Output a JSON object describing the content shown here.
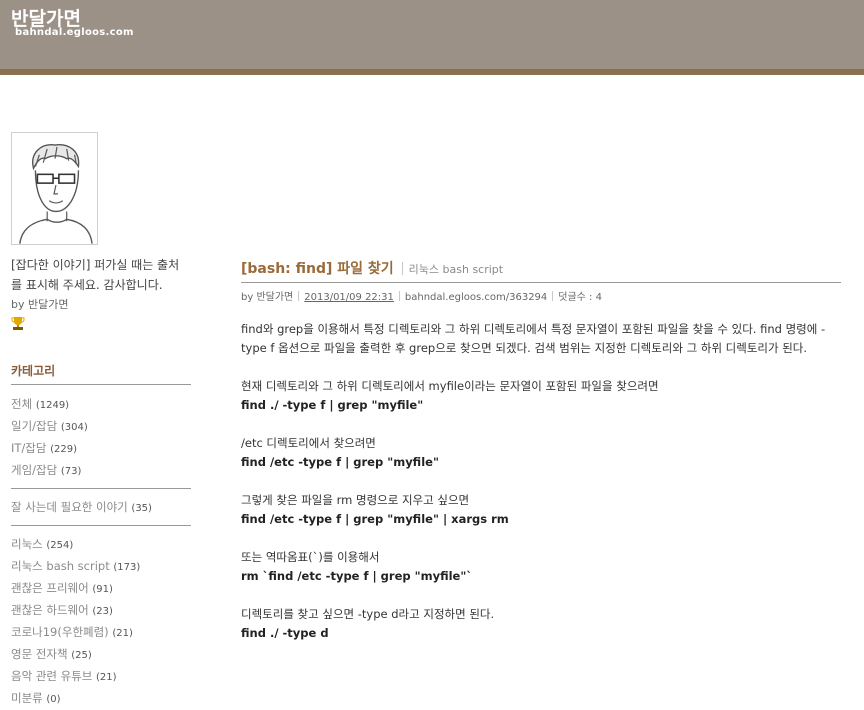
{
  "header": {
    "title": "반달가면",
    "url": "bahndal.egloos.com"
  },
  "sidebar": {
    "profile_text": "[잡다한 이야기] 퍼가실 때는 출처를 표시해 주세요. 감사합니다.",
    "by_label": "by",
    "by_author": "반달가면",
    "category_title": "카테고리",
    "groups": [
      [
        {
          "label": "전체",
          "count": "(1249)"
        },
        {
          "label": "일기/잡담",
          "count": "(304)"
        },
        {
          "label": "IT/잡담",
          "count": "(229)"
        },
        {
          "label": "게임/잡담",
          "count": "(73)"
        }
      ],
      [
        {
          "label": "잘 사는데 필요한 이야기",
          "count": "(35)"
        }
      ],
      [
        {
          "label": "리눅스",
          "count": "(254)"
        },
        {
          "label": "리눅스 bash script",
          "count": "(173)"
        },
        {
          "label": "괜찮은 프리웨어",
          "count": "(91)"
        },
        {
          "label": "괜찮은 하드웨어",
          "count": "(23)"
        },
        {
          "label": "코로나19(우한폐렴)",
          "count": "(21)"
        },
        {
          "label": "영문 전자책",
          "count": "(25)"
        },
        {
          "label": "음악 관련 유튜브",
          "count": "(21)"
        },
        {
          "label": "미분류",
          "count": "(0)"
        }
      ]
    ]
  },
  "post": {
    "title": "[bash: find] 파일 찾기",
    "category": "리눅스 bash script",
    "by": "by 반달가면",
    "date": "2013/01/09 22:31",
    "link": "bahndal.egloos.com/363294",
    "comments": "덧글수 : 4",
    "body": [
      {
        "text": "find와 grep을 이용해서 특정 디렉토리와 그 하위 디렉토리에서 특정 문자열이 포함된 파일을 찾을 수 있다. find 명령에 -type f 옵션으로 파일을 출력한 후 grep으로 찾으면 되겠다. 검색 범위는 지정한 디렉토리와 그 하위 디렉토리가 된다.",
        "bold": false
      },
      {
        "text": "",
        "bold": false
      },
      {
        "text": "현재 디렉토리와 그 하위 디렉토리에서 myfile이라는 문자열이 포함된 파일을 찾으려면",
        "bold": false
      },
      {
        "text": "find ./ -type f | grep \"myfile\"",
        "bold": true
      },
      {
        "text": "",
        "bold": false
      },
      {
        "text": "/etc 디렉토리에서 찾으려면",
        "bold": false
      },
      {
        "text": "find /etc -type f | grep \"myfile\"",
        "bold": true
      },
      {
        "text": "",
        "bold": false
      },
      {
        "text": "그렇게 찾은 파일을 rm 명령으로 지우고 싶으면",
        "bold": false
      },
      {
        "text": "find /etc -type f | grep \"myfile\" | xargs rm",
        "bold": true
      },
      {
        "text": "",
        "bold": false
      },
      {
        "text": "또는 역따옴표(`)를 이용해서",
        "bold": false
      },
      {
        "text": "rm `find /etc -type f | grep \"myfile\"`",
        "bold": true
      },
      {
        "text": "",
        "bold": false
      },
      {
        "text": "디렉토리를 찾고 싶으면 -type d라고 지정하면 된다.",
        "bold": false
      },
      {
        "text": "find ./ -type d",
        "bold": true
      }
    ]
  }
}
